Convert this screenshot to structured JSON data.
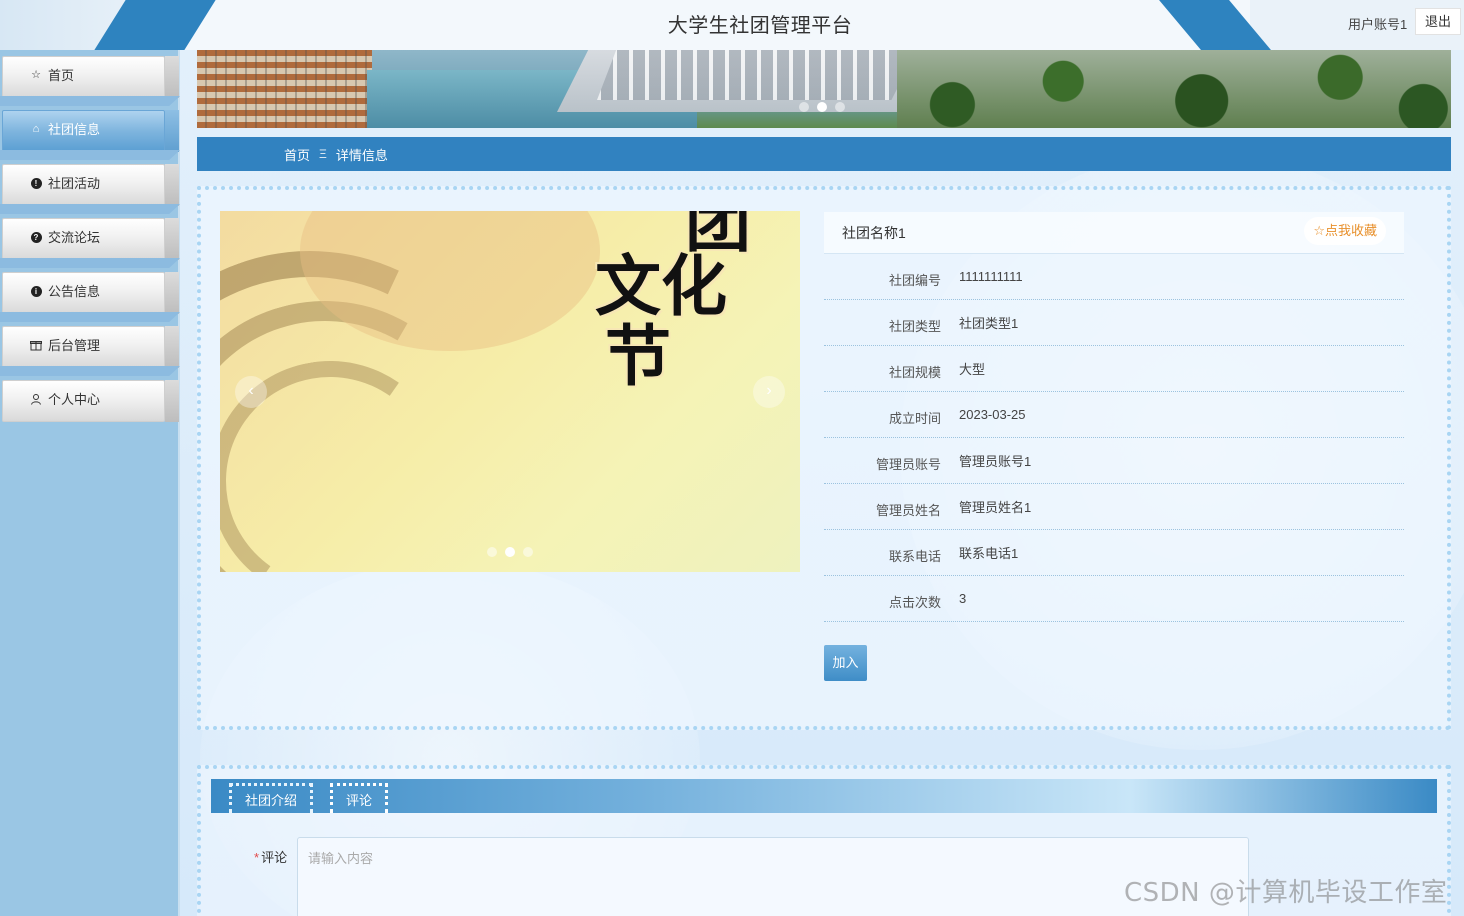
{
  "header": {
    "title": "大学生社团管理平台",
    "user_label": "用户账号1",
    "logout_label": "退出"
  },
  "sidebar": {
    "items": [
      {
        "label": "首页",
        "icon": "star-outline-icon",
        "active": false
      },
      {
        "label": "社团信息",
        "icon": "home-outline-icon",
        "active": true
      },
      {
        "label": "社团活动",
        "icon": "exclamation-circle-icon",
        "active": false
      },
      {
        "label": "交流论坛",
        "icon": "question-circle-icon",
        "active": false
      },
      {
        "label": "公告信息",
        "icon": "info-circle-icon",
        "active": false
      },
      {
        "label": "后台管理",
        "icon": "gift-icon",
        "active": false
      },
      {
        "label": "个人中心",
        "icon": "user-outline-icon",
        "active": false
      }
    ]
  },
  "breadcrumb": {
    "home": "首页",
    "separator": "Ξ",
    "current": "详情信息"
  },
  "gallery": {
    "headline_text": "团\n文化节"
  },
  "detail": {
    "name": "社团名称1",
    "favorite_label": "☆点我收藏",
    "fields": [
      {
        "key": "社团编号",
        "value": "1111111111"
      },
      {
        "key": "社团类型",
        "value": "社团类型1"
      },
      {
        "key": "社团规模",
        "value": "大型"
      },
      {
        "key": "成立时间",
        "value": "2023-03-25"
      },
      {
        "key": "管理员账号",
        "value": "管理员账号1"
      },
      {
        "key": "管理员姓名",
        "value": "管理员姓名1"
      },
      {
        "key": "联系电话",
        "value": "联系电话1"
      },
      {
        "key": "点击次数",
        "value": "3"
      }
    ],
    "join_label": "加入"
  },
  "tabs": {
    "items": [
      "社团介绍",
      "评论"
    ],
    "active": "评论"
  },
  "comment": {
    "required_mark": "*",
    "label": "评论",
    "placeholder": "请输入内容"
  },
  "watermark": "CSDN @计算机毕设工作室",
  "colors": {
    "accent": "#3182c0",
    "sidebar_bg": "#9ac6e4",
    "favorite": "#e8902c"
  }
}
